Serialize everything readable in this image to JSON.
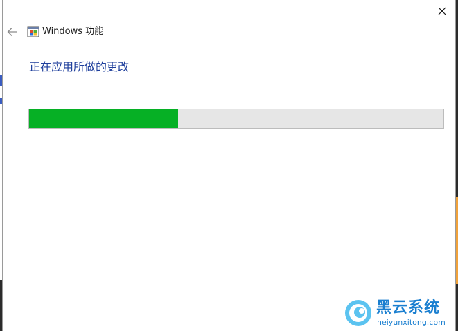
{
  "window": {
    "title": "Windows 功能",
    "icon": "windows-features-icon"
  },
  "controls": {
    "close_icon": "close-icon",
    "back_icon": "back-arrow-icon"
  },
  "main": {
    "heading": "正在应用所做的更改",
    "progress": 0.36
  },
  "watermark": {
    "name": "黑云系统",
    "domain": "heiyunxitong.com"
  },
  "colors": {
    "accent_heading": "#1f3f9c",
    "progress_fill": "#06b025",
    "progress_track": "#e6e6e6",
    "watermark": "#1a7fd0"
  }
}
